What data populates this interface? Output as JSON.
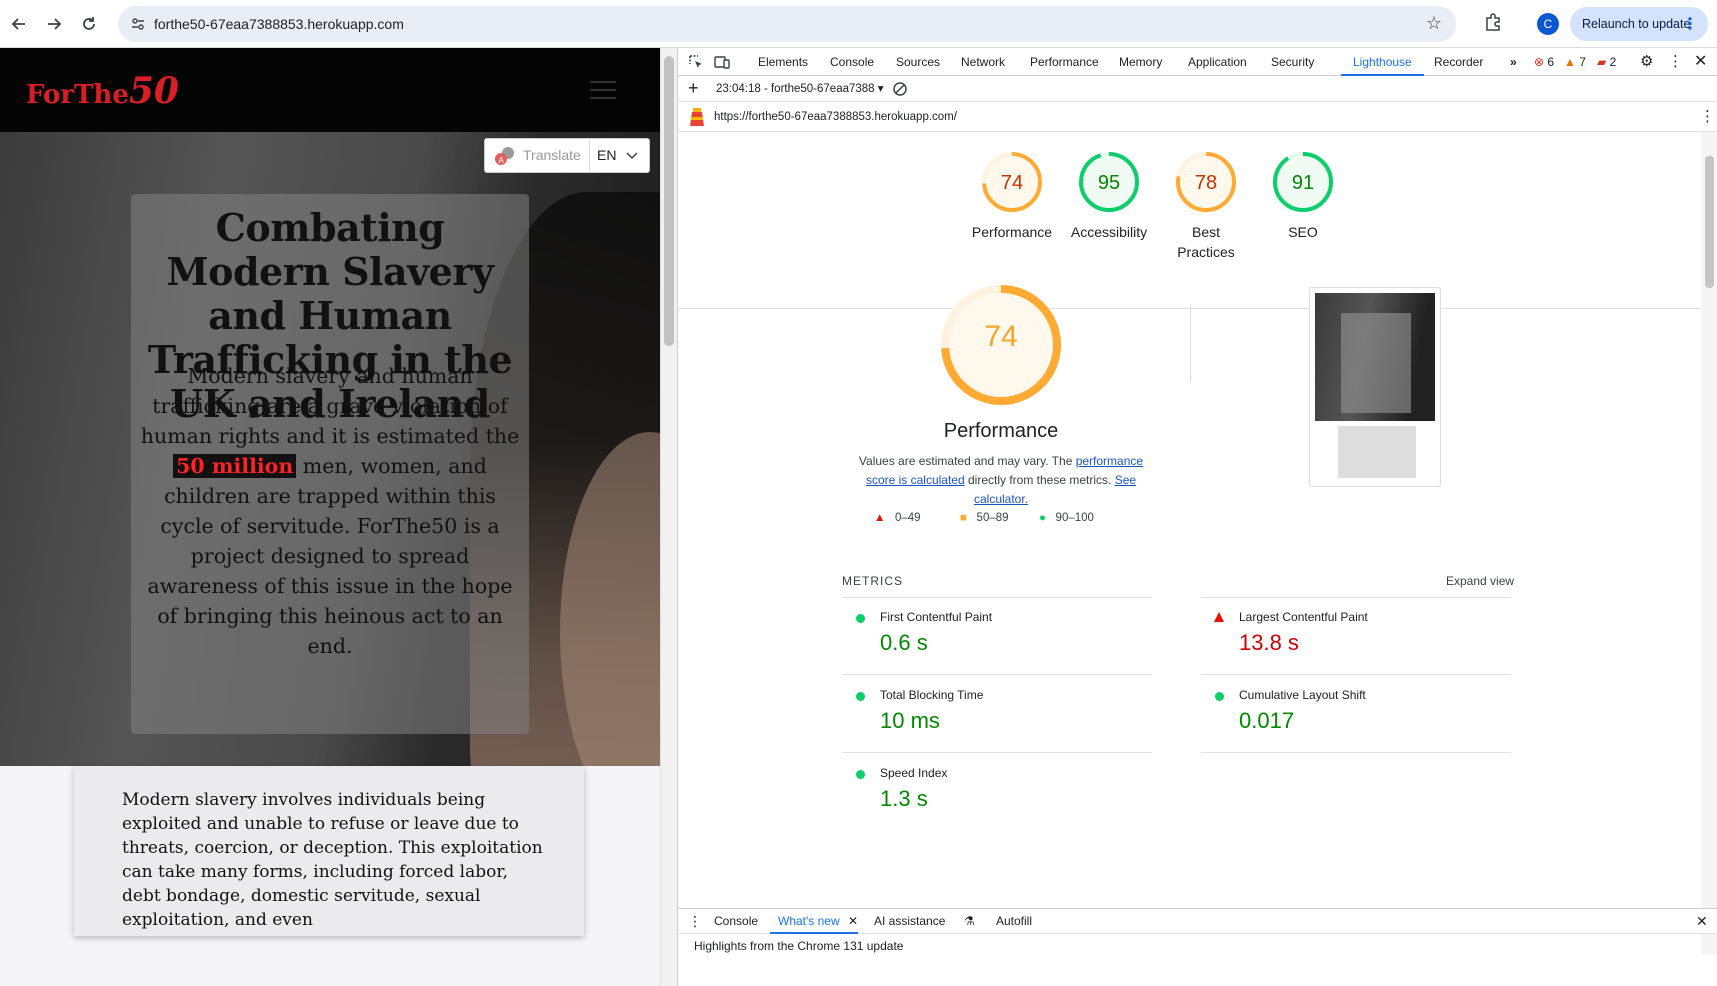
{
  "browser": {
    "url": "forthe50-67eaa7388853.herokuapp.com",
    "profile_initial": "C",
    "relaunch_label": "Relaunch to update"
  },
  "site": {
    "logo_text": "ForThe",
    "logo_number": "50",
    "translate_label": "Translate",
    "language": "EN",
    "hero_title": "Combating Modern Slavery and Human Trafficking in the UK and Ireland",
    "hero_text_before": "Modern slavery and human trafficking are a grave violation of human rights and it is estimated the ",
    "hero_highlight": "50 million",
    "hero_text_after": " men, women, and children are trapped within this cycle of servitude. ForThe50 is a project designed to spread awareness of this issue in the hope of bringing this heinous act to an end.",
    "info_text": "Modern slavery involves individuals being exploited and unable to refuse or leave due to threats, coercion, or deception. This exploitation can take many forms, including forced labor, debt bondage, domestic servitude, sexual exploitation, and even"
  },
  "devtools": {
    "tabs": [
      "Elements",
      "Console",
      "Sources",
      "Network",
      "Performance",
      "Memory",
      "Application",
      "Security",
      "Lighthouse",
      "Recorder"
    ],
    "active_tab": "Lighthouse",
    "errors": "6",
    "warnings": "7",
    "issues": "2",
    "report_select": "23:04:18 - forthe50-67eaa7388",
    "report_url": "https://forthe50-67eaa7388853.herokuapp.com/",
    "scores": [
      {
        "label": "Performance",
        "value": "74",
        "color": "#fa3",
        "text_color": "#c33300"
      },
      {
        "label": "Accessibility",
        "value": "95",
        "color": "#0cce6b",
        "text_color": "#008800"
      },
      {
        "label": "Best Practices",
        "value": "78",
        "color": "#fa3",
        "text_color": "#c33300"
      },
      {
        "label": "SEO",
        "value": "91",
        "color": "#0cce6b",
        "text_color": "#008800"
      }
    ],
    "performance": {
      "score": "74",
      "title": "Performance",
      "desc_before": "Values are estimated and may vary. The ",
      "desc_link1": "performance score is calculated",
      "desc_mid": " directly from these metrics. ",
      "desc_link2": "See calculator."
    },
    "legend": {
      "fail": "0–49",
      "average": "50–89",
      "pass": "90–100"
    },
    "metrics_label": "METRICS",
    "expand_label": "Expand view",
    "metrics": [
      {
        "name": "First Contentful Paint",
        "value": "0.6 s",
        "status": "pass"
      },
      {
        "name": "Largest Contentful Paint",
        "value": "13.8 s",
        "status": "fail"
      },
      {
        "name": "Total Blocking Time",
        "value": "10 ms",
        "status": "pass"
      },
      {
        "name": "Cumulative Layout Shift",
        "value": "0.017",
        "status": "pass"
      },
      {
        "name": "Speed Index",
        "value": "1.3 s",
        "status": "pass"
      }
    ],
    "drawer_tabs": [
      "Console",
      "What's new",
      "AI assistance",
      "Autofill"
    ],
    "drawer_active": "What's new",
    "drawer_text": "Highlights from the Chrome 131 update"
  },
  "colors": {
    "brand_red": "#d81f26",
    "pass": "#0cce6b",
    "average": "#fa3",
    "fail": "#eb0f00",
    "devtools_accent": "#1a73e8"
  }
}
